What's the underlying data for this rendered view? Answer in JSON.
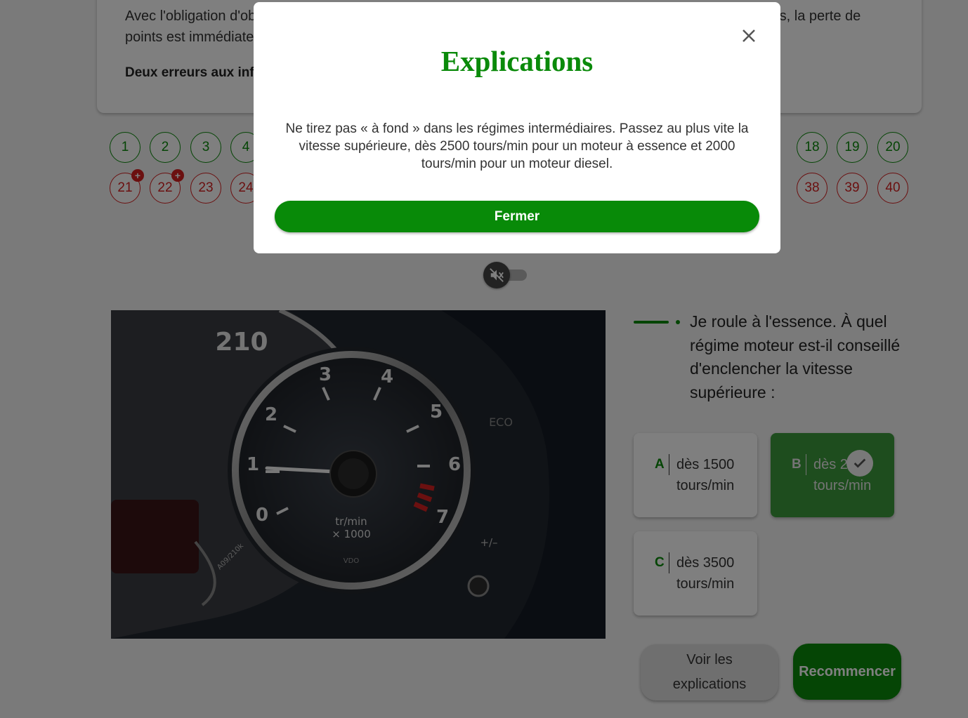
{
  "intro": {
    "line1": "Avec l'obligation d'obtenir la preuve du paiement de l'amende forfaitaire concernant des infractions légères, la perte de points est immédiate.",
    "bold": "Deux erreurs aux infractions sont autorisées"
  },
  "question_nav": {
    "row1": [
      {
        "n": "1",
        "status": "ok"
      },
      {
        "n": "2",
        "status": "ok"
      },
      {
        "n": "3",
        "status": "ok"
      },
      {
        "n": "4",
        "status": "ok"
      },
      {
        "n": "18",
        "status": "ok"
      },
      {
        "n": "19",
        "status": "ok"
      },
      {
        "n": "20",
        "status": "ok"
      }
    ],
    "row2": [
      {
        "n": "21",
        "status": "bad",
        "badge": "+"
      },
      {
        "n": "22",
        "status": "bad",
        "badge": "+"
      },
      {
        "n": "23",
        "status": "bad"
      },
      {
        "n": "24",
        "status": "bad"
      },
      {
        "n": "38",
        "status": "bad"
      },
      {
        "n": "39",
        "status": "bad"
      },
      {
        "n": "40",
        "status": "bad"
      }
    ]
  },
  "sound_toggle": {
    "icon": "speaker-muted-icon",
    "state": "off"
  },
  "photo": {
    "speedometer_label": "210",
    "tach_numbers": [
      "0",
      "1",
      "2",
      "3",
      "4",
      "5",
      "6",
      "7"
    ],
    "tach_unit_line1": "tr/min",
    "tach_unit_line2": "× 1000",
    "brand": "VDO",
    "eco_label": "ECO",
    "plus_minus_label": "+/–",
    "odo_label": "A09/210k"
  },
  "question": {
    "text": "Je roule à l'essence. À quel régime moteur est-il conseillé d'enclencher la vitesse supérieure :"
  },
  "answers": [
    {
      "letter": "A",
      "text": "dès 1500 tours/min",
      "selected": false
    },
    {
      "letter": "B",
      "text": "dès 2 tours/min",
      "selected": true
    },
    {
      "letter": "C",
      "text": "dès 3500 tours/min",
      "selected": false
    }
  ],
  "buttons": {
    "explain": "Voir les explications",
    "restart": "Recommencer"
  },
  "modal": {
    "title": "Explications",
    "body": "Ne tirez pas « à fond » dans les régimes intermédiaires. Passez au plus vite la vitesse supérieure, dès 2500 tours/min pour un moteur à essence et 2000 tours/min pour un moteur diesel.",
    "close_button": "Fermer"
  },
  "colors": {
    "accent": "#0a8a0a",
    "error": "#d62020",
    "selected": "#3d9a3d"
  }
}
